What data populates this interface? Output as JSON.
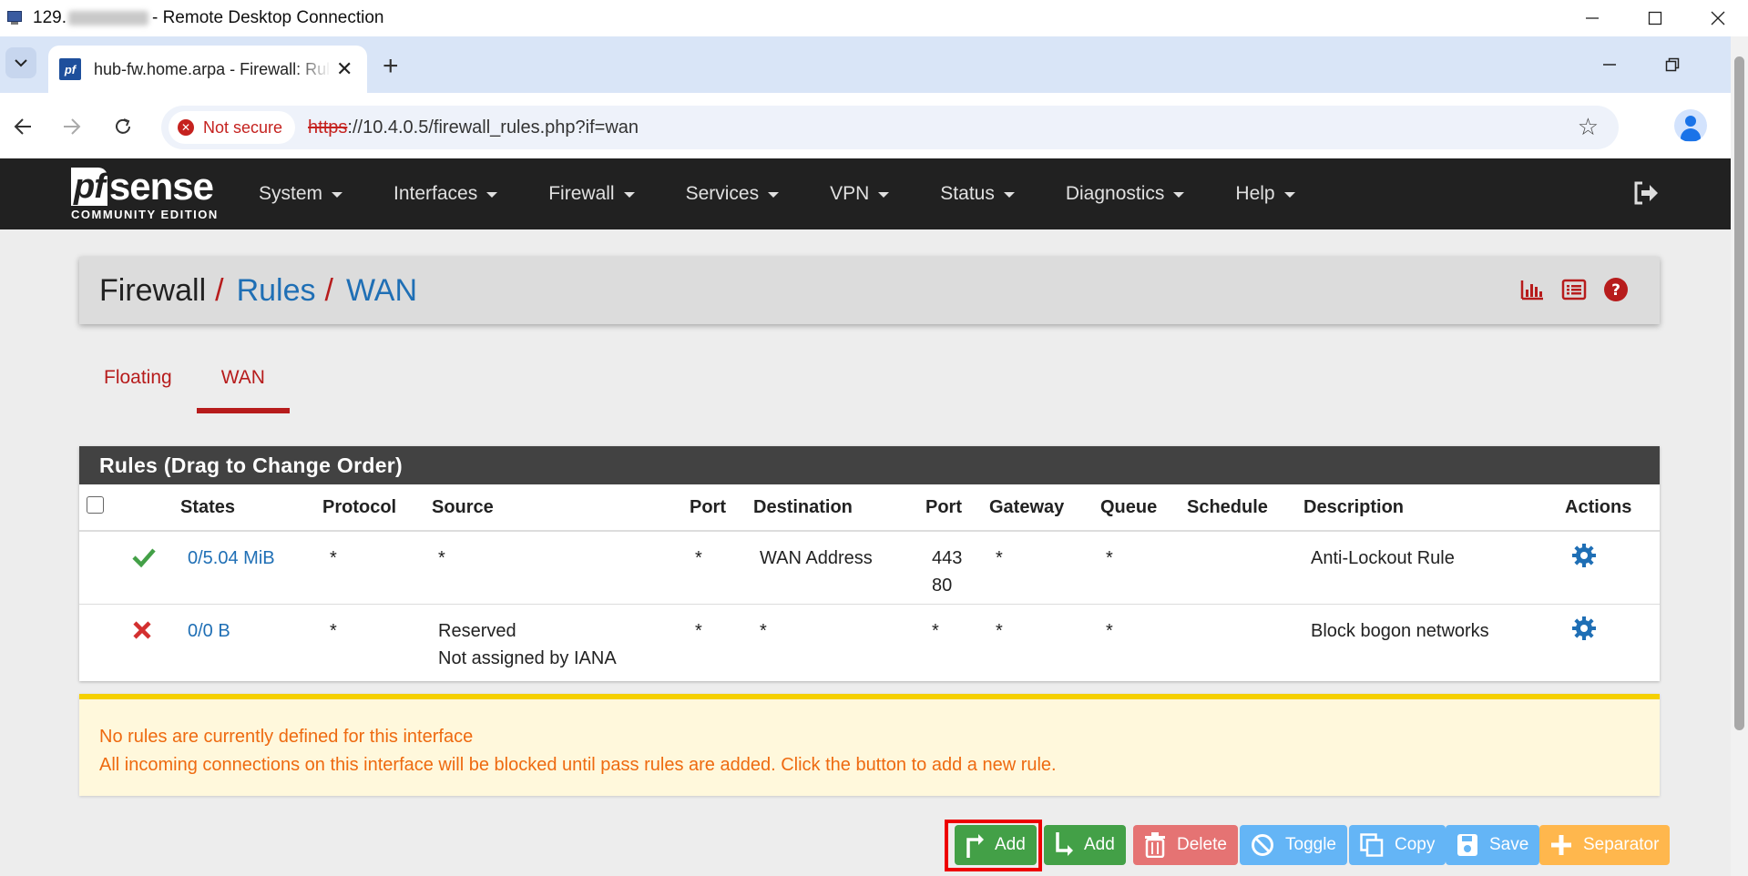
{
  "rdp": {
    "title_prefix": "129.",
    "title_suffix": "- Remote Desktop Connection"
  },
  "browser": {
    "tab_title": "hub-fw.home.arpa - Firewall: Rules: WAN",
    "security_label": "Not secure",
    "url_scheme": "https",
    "url_rest": "://10.4.0.5/firewall_rules.php?if=wan"
  },
  "pfsense": {
    "logo_brand": "sense",
    "logo_pf": "pf",
    "logo_edition": "COMMUNITY EDITION",
    "menu": [
      "System",
      "Interfaces",
      "Firewall",
      "Services",
      "VPN",
      "Status",
      "Diagnostics",
      "Help"
    ]
  },
  "breadcrumb": {
    "root": "Firewall",
    "sep": "/",
    "level1": "Rules",
    "level2": "WAN"
  },
  "tabs": [
    "Floating",
    "WAN"
  ],
  "rules": {
    "panel_title": "Rules (Drag to Change Order)",
    "columns": [
      "States",
      "Protocol",
      "Source",
      "Port",
      "Destination",
      "Port",
      "Gateway",
      "Queue",
      "Schedule",
      "Description",
      "Actions"
    ],
    "rows": [
      {
        "status": "pass",
        "states": "0/5.04 MiB",
        "protocol": "*",
        "source": "*",
        "source_port": "*",
        "destination": "WAN Address",
        "dest_port": "443\n80",
        "gateway": "*",
        "queue": "*",
        "schedule": "",
        "description": "Anti-Lockout Rule"
      },
      {
        "status": "block",
        "states": "0/0 B",
        "protocol": "*",
        "source": "Reserved\nNot assigned by IANA",
        "source_port": "*",
        "destination": "*",
        "dest_port": "*",
        "gateway": "*",
        "queue": "*",
        "schedule": "",
        "description": "Block bogon networks"
      }
    ]
  },
  "alert": {
    "line1": "No rules are currently defined for this interface",
    "line2": "All incoming connections on this interface will be blocked until pass rules are added. Click the button to add a new rule."
  },
  "buttons": {
    "add_top": "Add",
    "add_bottom": "Add",
    "delete": "Delete",
    "toggle": "Toggle",
    "copy": "Copy",
    "save": "Save",
    "separator": "Separator"
  },
  "colors": {
    "nav_bg": "#212121",
    "accent_red": "#b71c1c",
    "link_blue": "#1f6fb5",
    "alert_text": "#ee6a10",
    "green": "#43a047"
  }
}
